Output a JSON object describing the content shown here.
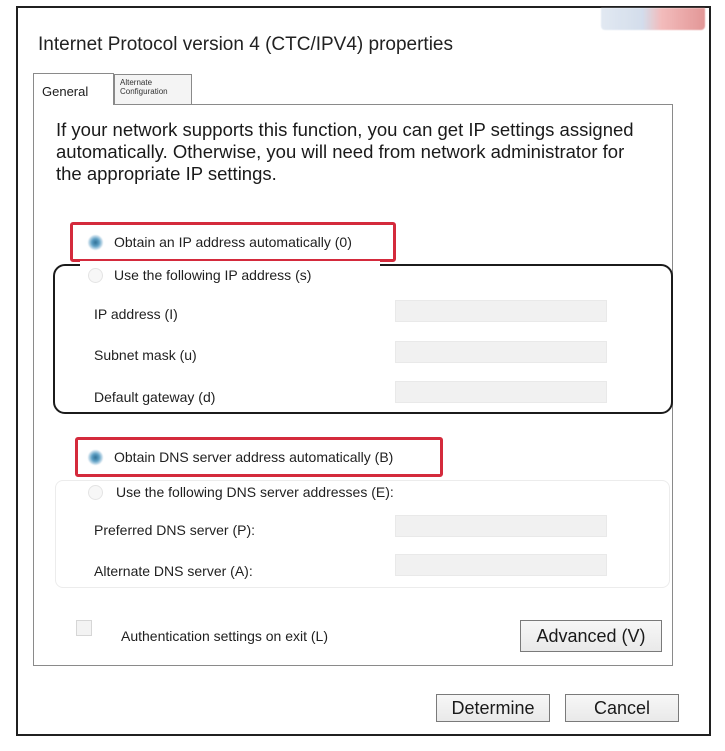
{
  "window": {
    "title": "Internet Protocol version 4 (CTC/IPV4) properties"
  },
  "tabs": [
    {
      "label": "General",
      "selected": true
    },
    {
      "label_line1": "Alternate",
      "label_line2": "Configuration",
      "selected": false
    }
  ],
  "intro_text": "If your network supports this function, you can get IP settings assigned automatically. Otherwise, you will need from network administrator for the appropriate IP settings.",
  "ip": {
    "auto_label": "Obtain an IP address automatically (0)",
    "auto_selected": true,
    "manual_label": "Use the following IP address (s)",
    "manual_selected": false,
    "fields": [
      {
        "label": "IP address (I)",
        "value": ""
      },
      {
        "label": "Subnet mask (u)",
        "value": ""
      },
      {
        "label": "Default gateway (d)",
        "value": ""
      }
    ]
  },
  "dns": {
    "auto_label": "Obtain DNS server address automatically (B)",
    "auto_selected": true,
    "manual_label": "Use the following DNS server addresses (E):",
    "manual_selected": false,
    "fields": [
      {
        "label": "Preferred DNS server (P):",
        "value": ""
      },
      {
        "label": "Alternate DNS server (A):",
        "value": ""
      }
    ]
  },
  "auth_checkbox": {
    "label": "Authentication settings on exit (L)",
    "checked": false
  },
  "buttons": {
    "advanced": "Advanced (V)",
    "ok": "Determine",
    "cancel": "Cancel"
  },
  "colors": {
    "highlight": "#d42a3c",
    "radio_selected": "#2e6f95"
  },
  "icons": {
    "window_controls": "minimize-maximize-close-icon"
  }
}
